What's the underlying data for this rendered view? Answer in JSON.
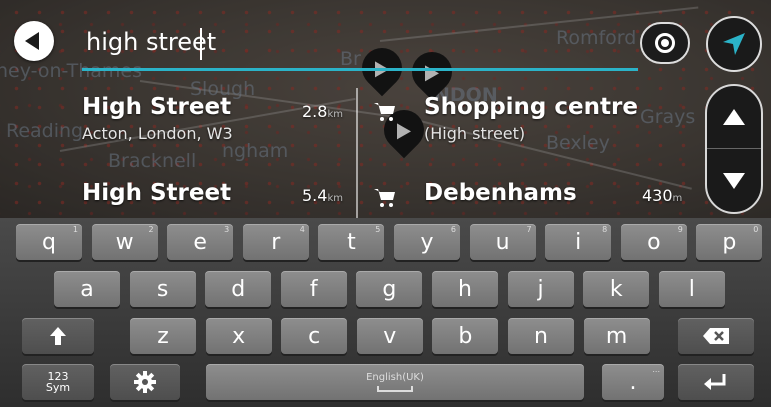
{
  "map": {
    "labels": [
      "Romford",
      "Grays",
      "Slough",
      "Reading",
      "Bracknell",
      "Bexley",
      "ney-on-Thames",
      "Br",
      "NDON",
      "ngham"
    ]
  },
  "search": {
    "query": "high street"
  },
  "results": {
    "left": [
      {
        "title": "High Street",
        "subtitle": "Acton, London, W3",
        "distance": "2.8",
        "unit": "km"
      },
      {
        "title": "High Street",
        "subtitle": "",
        "distance": "5.4",
        "unit": "km"
      }
    ],
    "right": [
      {
        "title": "Shopping centre",
        "subtitle": "(High street)",
        "distance": "",
        "unit": "",
        "icon": "cart-icon"
      },
      {
        "title": "Debenhams",
        "subtitle": "",
        "distance": "430",
        "unit": "m",
        "icon": "cart-icon"
      }
    ]
  },
  "keyboard": {
    "row1": [
      {
        "k": "q",
        "h": "1"
      },
      {
        "k": "w",
        "h": "2"
      },
      {
        "k": "e",
        "h": "3"
      },
      {
        "k": "r",
        "h": "4"
      },
      {
        "k": "t",
        "h": "5"
      },
      {
        "k": "y",
        "h": "6"
      },
      {
        "k": "u",
        "h": "7"
      },
      {
        "k": "i",
        "h": "8"
      },
      {
        "k": "o",
        "h": "9"
      },
      {
        "k": "p",
        "h": "0"
      }
    ],
    "row2": [
      "a",
      "s",
      "d",
      "f",
      "g",
      "h",
      "j",
      "k",
      "l"
    ],
    "row3": [
      "z",
      "x",
      "c",
      "v",
      "b",
      "n",
      "m"
    ],
    "sym_line1": "123",
    "sym_line2": "Sym",
    "space_label": "English(UK)",
    "period_label": ".",
    "period_hint": "...",
    "icons": {
      "shift": "shift-arrow-icon",
      "backspace": "backspace-icon",
      "settings": "gear-icon",
      "enter": "enter-arrow-icon"
    }
  },
  "colors": {
    "accent": "#2bb3c8",
    "key": "#808080",
    "key_dark": "#575757"
  }
}
